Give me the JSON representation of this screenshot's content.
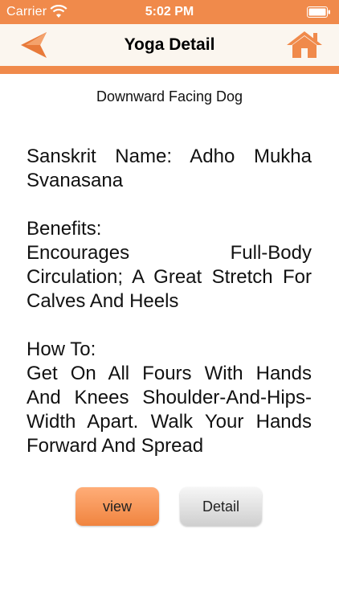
{
  "status_bar": {
    "carrier": "Carrier",
    "time": "5:02 PM"
  },
  "nav_bar": {
    "title": "Yoga Detail",
    "back_icon": "back-arrow-icon",
    "home_icon": "home-icon"
  },
  "pose": {
    "name": "Downward Facing Dog"
  },
  "detail": {
    "sanskrit": "Sanskrit Name: Adho Mukha Svanasana",
    "benefits_label": "Benefits:",
    "benefits_text": "Encourages Full-Body Circulation; A Great Stretch For Calves And Heels",
    "howto_label": "How To:",
    "howto_text": "Get On All Fours With Hands And Knees Shoulder-And-Hips-Width Apart. Walk Your Hands Forward And Spread"
  },
  "buttons": {
    "view_label": "view",
    "detail_label": "Detail"
  },
  "colors": {
    "accent": "#f08a4b",
    "nav_background": "#fbf6ef"
  }
}
